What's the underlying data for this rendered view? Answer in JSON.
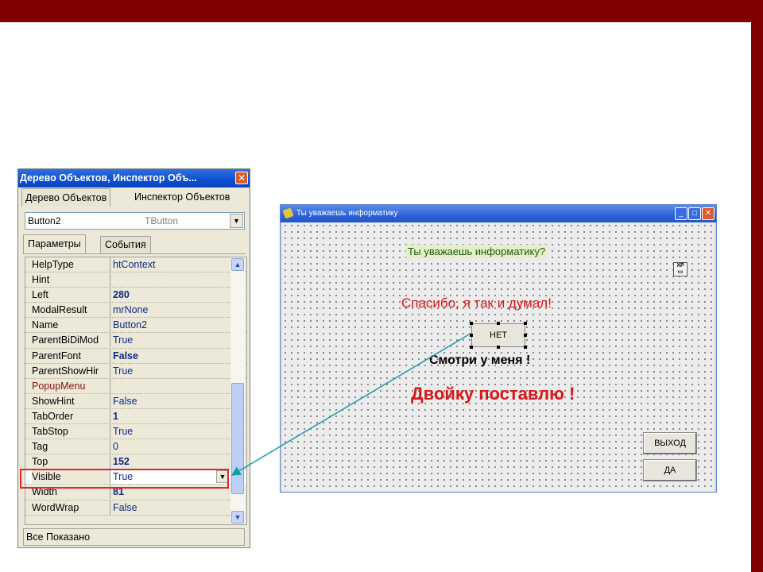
{
  "inspector": {
    "title": "Дерево Объектов, Инспектор Объ...",
    "tab_tree": "Дерево Объектов",
    "tab_inspector": "Инспектор Объектов",
    "component_name": "Button2",
    "component_type": "TButton",
    "tab_params": "Параметры",
    "tab_events": "События",
    "status": "Все Показано",
    "properties": [
      {
        "name": "HelpType",
        "value": "htContext"
      },
      {
        "name": "Hint",
        "value": ""
      },
      {
        "name": "Left",
        "value": "280"
      },
      {
        "name": "ModalResult",
        "value": "mrNone"
      },
      {
        "name": "Name",
        "value": "Button2"
      },
      {
        "name": "ParentBiDiMod",
        "value": "True"
      },
      {
        "name": "ParentFont",
        "value": "False"
      },
      {
        "name": "ParentShowHir",
        "value": "True"
      },
      {
        "name": "PopupMenu",
        "value": ""
      },
      {
        "name": "ShowHint",
        "value": "False"
      },
      {
        "name": "TabOrder",
        "value": "1"
      },
      {
        "name": "TabStop",
        "value": "True"
      },
      {
        "name": "Tag",
        "value": "0"
      },
      {
        "name": "Top",
        "value": "152"
      },
      {
        "name": "Visible",
        "value": "True"
      },
      {
        "name": "Width",
        "value": "81"
      },
      {
        "name": "WordWrap",
        "value": "False"
      }
    ]
  },
  "form": {
    "title": "Ты уважаешь информатику",
    "label_question": "Ты уважаешь информатику?",
    "label_thanks": "Спасибо, я так и думал!",
    "label_watch": "Смотри у меня !",
    "label_grade": "Двойку поставлю !",
    "btn_no": "НЕТ",
    "btn_exit": "ВЫХОД",
    "btn_yes": "ДА",
    "xp_icon": "XP"
  },
  "colors": {
    "top_bar": "#800000",
    "highlight": "#e0282c",
    "arrow": "#1a9aa8"
  }
}
